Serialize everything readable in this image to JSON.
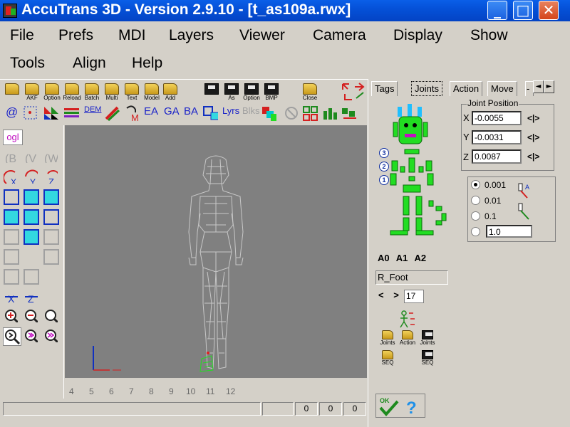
{
  "window": {
    "title": "AccuTrans 3D - Version 2.9.10 - [t_as109a.rwx]",
    "minimize": "_",
    "maximize": "□",
    "close": "✕"
  },
  "menu": {
    "row1": [
      "File",
      "Prefs",
      "MDI",
      "Layers",
      "Viewer",
      "Camera",
      "Display",
      "Show"
    ],
    "row2": [
      "Tools",
      "Align",
      "Help"
    ]
  },
  "toolbar1": {
    "akf": "AKF",
    "option": "Option",
    "reload": "Reload",
    "batch": "Batch",
    "multi": "Multi",
    "text": "Text",
    "model": "Model",
    "add": "Add",
    "as": "As",
    "option2": "Option",
    "bmp": "BMP",
    "close": "Close"
  },
  "toolbar2": {
    "at": "@",
    "dem": "DEM",
    "ea": "EA",
    "ga": "GA",
    "ba": "BA",
    "lyrs": "Lyrs",
    "blks": "Blks"
  },
  "left_tools": {
    "ogl": "ogl"
  },
  "ruler": [
    "4",
    "5",
    "6",
    "7",
    "8",
    "9",
    "10",
    "11",
    "12"
  ],
  "status": [
    "0",
    "0",
    "0"
  ],
  "tabs": [
    "Tags",
    "Joints",
    "Action",
    "Move",
    "-"
  ],
  "tab_arrows": {
    "left": "◄",
    "right": "►"
  },
  "joint_position": {
    "title": "Joint Position",
    "x_label": "X",
    "y_label": "Y",
    "z_label": "Z",
    "x": "-0.0055",
    "y": "-0.0031",
    "z": "0.0087",
    "step": "<|>"
  },
  "increment": {
    "options": [
      "0.001",
      "0.01",
      "0.1"
    ],
    "custom": "1.0",
    "selected": "0.001"
  },
  "skeleton_numbers": [
    "3",
    "2",
    "1"
  ],
  "a_labels": [
    "A0",
    "A1",
    "A2"
  ],
  "joint_name": "R_Foot",
  "nav": {
    "prev": "<",
    "next": ">",
    "index": "17"
  },
  "joint_buttons": {
    "joints_open": "Joints",
    "action_open": "Action",
    "joints_save": "Joints",
    "seq_open": "SEQ",
    "seq_save": "SEQ"
  },
  "colors": {
    "titlebar": "#0551d8",
    "viewport": "#808080",
    "skeleton": "#22dd22",
    "wireframe": "#c8c8c8"
  }
}
